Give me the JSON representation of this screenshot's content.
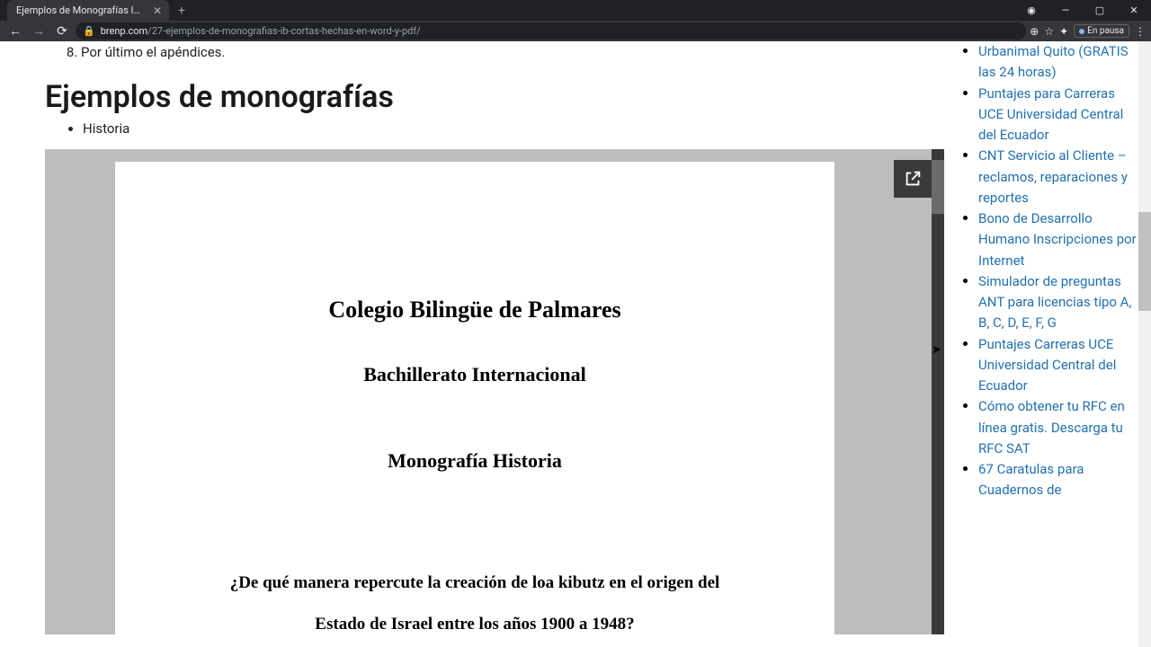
{
  "browser": {
    "tab_title": "Ejemplos de Monografías IB cort",
    "url_domain": "brenp.com",
    "url_path": "/27-ejemplos-de-monografias-ib-cortas-hechas-en-word-y-pdf/",
    "pause_label": "En pausa"
  },
  "article": {
    "ol_start": 8,
    "ol_item": "Por último el apéndices.",
    "heading": "Ejemplos de monografías",
    "bullet": "Historia",
    "doc": {
      "line1": "Colegio Bilingüe de Palmares",
      "line2": "Bachillerato Internacional",
      "line3": "Monografía Historia",
      "line4a": "¿De qué manera repercute la creación de loa kibutz en el origen del",
      "line4b": "Estado de Israel entre los años 1900 a 1948?"
    }
  },
  "sidebar": {
    "links": [
      "Urbanimal Quito (GRATIS las 24 horas)",
      "Puntajes para Carreras UCE Universidad Central del Ecuador",
      "CNT Servicio al Cliente – reclamos, reparaciones y reportes",
      "Bono de Desarrollo Humano Inscripciones por Internet",
      "Simulador de preguntas ANT para licencias tipo A, B, C, D, E, F, G",
      "Puntajes Carreras UCE Universidad Central del Ecuador",
      "Cómo obtener tu RFC en línea gratis. Descarga tu RFC SAT",
      "67 Caratulas para Cuadernos de"
    ]
  }
}
